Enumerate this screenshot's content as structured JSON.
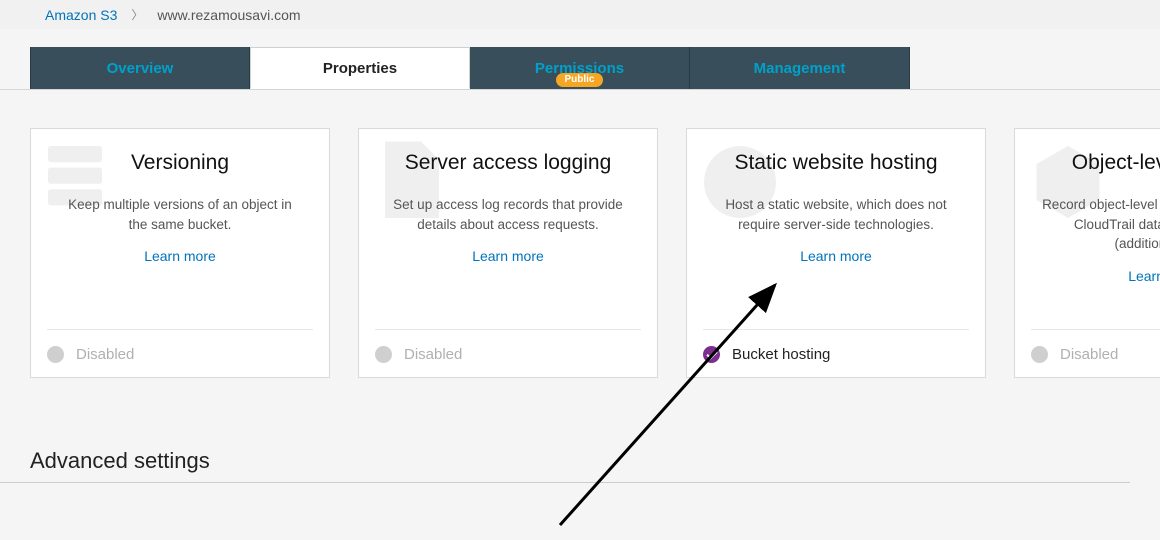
{
  "breadcrumb": {
    "root": "Amazon S3",
    "current": "www.rezamousavi.com"
  },
  "tabs": [
    {
      "label": "Overview",
      "active": false,
      "badge": null
    },
    {
      "label": "Properties",
      "active": true,
      "badge": null
    },
    {
      "label": "Permissions",
      "active": false,
      "badge": "Public"
    },
    {
      "label": "Management",
      "active": false,
      "badge": null
    }
  ],
  "cards": [
    {
      "title": "Versioning",
      "desc": "Keep multiple versions of an object in the same bucket.",
      "learn": "Learn more",
      "status": {
        "enabled": false,
        "label": "Disabled"
      }
    },
    {
      "title": "Server access logging",
      "desc": "Set up access log records that provide details about access requests.",
      "learn": "Learn more",
      "status": {
        "enabled": false,
        "label": "Disabled"
      }
    },
    {
      "title": "Static website hosting",
      "desc": "Host a static website, which does not require server-side technologies.",
      "learn": "Learn more",
      "status": {
        "enabled": true,
        "label": "Bucket hosting"
      }
    },
    {
      "title": "Object-level logging",
      "desc": "Record object-level API activity using the CloudTrail data events feature (additional cost).",
      "learn": "Learn more",
      "status": {
        "enabled": false,
        "label": "Disabled"
      }
    }
  ],
  "section": {
    "advanced_title": "Advanced settings"
  },
  "colors": {
    "link": "#0073bb",
    "tab_bg": "#394e5b",
    "tab_text": "#00a1c9",
    "badge": "#f5a623",
    "enabled_dot": "#7b2e8e"
  }
}
